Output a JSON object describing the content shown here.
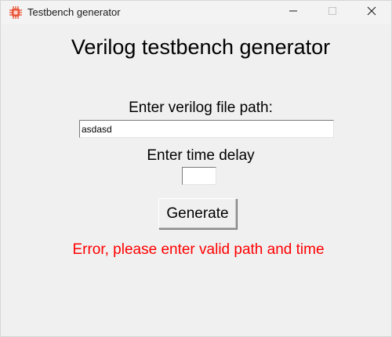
{
  "window": {
    "title": "Testbench generator",
    "icon": "circuit-chip-icon",
    "controls": {
      "minimize_icon": "minimize-icon",
      "maximize_icon": "maximize-icon",
      "close_icon": "close-icon"
    }
  },
  "main": {
    "heading": "Verilog testbench generator",
    "file_path_label": "Enter verilog file path:",
    "file_path_value": "asdasd",
    "time_delay_label": "Enter time delay",
    "time_delay_value": "",
    "generate_button_label": "Generate",
    "error_message": "Error, please enter valid path and time"
  },
  "colors": {
    "window_background": "#f0f0f0",
    "error_text": "#ff0000",
    "icon_accent": "#e8573c"
  }
}
